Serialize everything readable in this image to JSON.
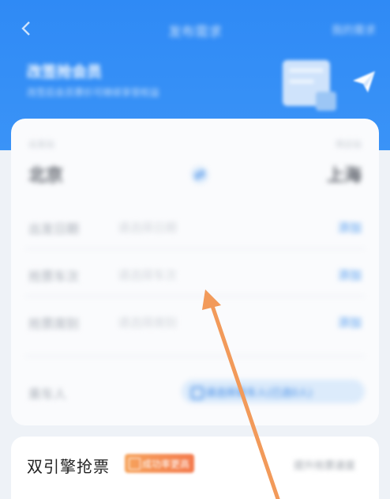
{
  "header": {
    "title": "发布需求",
    "right_label": "我的需求",
    "promo_title": "改签抢会员",
    "promo_subtitle": "改签后会员票价可继续享受权益"
  },
  "route": {
    "from_caption": "出发站",
    "from_station": "北京",
    "to_caption": "到达站",
    "to_station": "上海"
  },
  "fields": [
    {
      "label": "出发日期",
      "value": "请选择日期",
      "action": "添加"
    },
    {
      "label": "抢票车次",
      "value": "请选择车次",
      "action": "添加"
    },
    {
      "label": "抢票席别",
      "value": "请选择席别",
      "action": "添加"
    }
  ],
  "passengers": {
    "label": "乘车人",
    "pill_text": "请选择乘车人(已选0人)"
  },
  "engine": {
    "title": "双引擎抢票",
    "badge_text": "成功率更高",
    "right_text": "提升抢票速度"
  },
  "colors": {
    "header_blue": "#2f8af5",
    "action_blue": "#4c99ef",
    "badge_orange": "#f47a4d",
    "annotation_arrow": "#f29a5a"
  }
}
